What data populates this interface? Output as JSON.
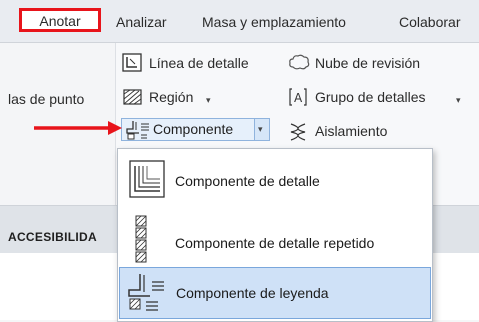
{
  "tabs": [
    {
      "label": "Anotar",
      "active": true
    },
    {
      "label": "Analizar"
    },
    {
      "label": "Masa y emplazamiento"
    },
    {
      "label": "Colaborar"
    }
  ],
  "ribbon": {
    "left_cut_label": "las de punto",
    "detail_line": "Línea de detalle",
    "revision_cloud": "Nube de revisión",
    "region": "Región",
    "detail_group": "Grupo de detalles",
    "component": "Componente",
    "insulation": "Aislamiento",
    "dropdown_arrow": "▾"
  },
  "strip": {
    "label": "ACCESIBILIDA"
  },
  "menu": {
    "items": [
      {
        "label": "Componente de detalle",
        "icon": "detail-component-icon"
      },
      {
        "label": "Componente de detalle repetido",
        "icon": "repeating-detail-component-icon"
      },
      {
        "label": "Componente de leyenda",
        "icon": "legend-component-icon",
        "selected": true
      }
    ]
  },
  "colors": {
    "highlight_red": "#e8141b",
    "selection_blue": "#cfe1f7",
    "selection_border": "#7aa7dc"
  }
}
